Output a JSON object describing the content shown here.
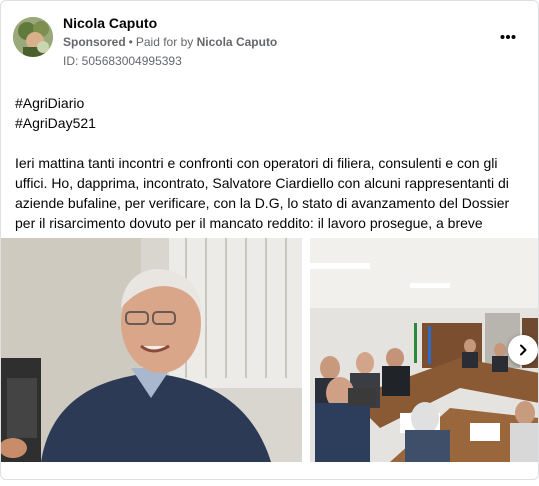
{
  "post": {
    "author": "Nicola Caputo",
    "sponsored_label": "Sponsored",
    "separator": "•",
    "paid_for_prefix": "Paid for by",
    "payer": "Nicola Caputo",
    "ad_id": "ID: 505683004995393",
    "hashtags": [
      "#AgriDiario",
      "#AgriDay521"
    ],
    "body": "Ieri mattina tanti incontri e confronti con operatori di filiera, consulenti e con gli uffici. Ho, dapprima, incontrato, Salvatore Ciardiello con alcuni rappresentanti di aziende bufaline, per verificare, con la D.G, lo stato di avanzamento del Dossier per il risarcimento dovuto per il mancato reddito: il lavoro prosegue, a breve daremo…",
    "more_menu_icon": "three-dots-icon"
  },
  "carousel": {
    "images": [
      {
        "subject": "smiling-man-portrait"
      },
      {
        "subject": "meeting-room-table"
      }
    ],
    "next_icon": "chevron-right-icon"
  },
  "colors": {
    "text": "#050505",
    "secondary": "#65676b",
    "border": "#dddfe2"
  }
}
